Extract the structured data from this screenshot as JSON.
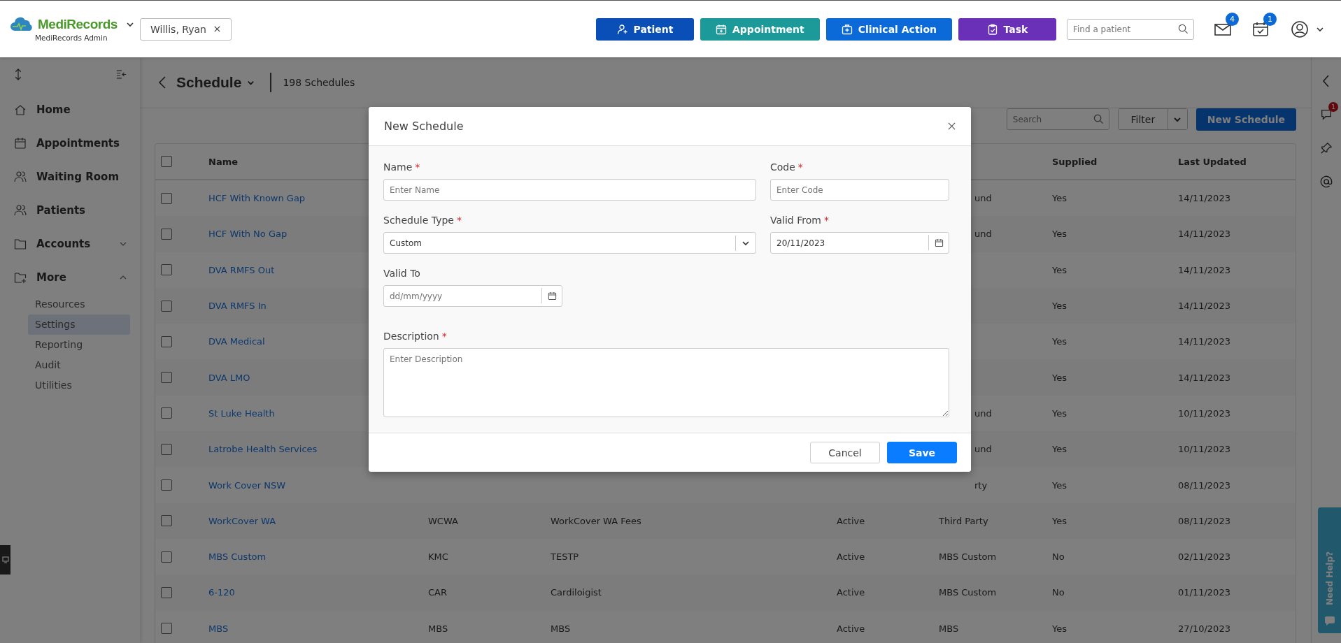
{
  "app": {
    "brand": "MediRecords",
    "subtitle": "MediRecords Admin"
  },
  "patient_chip": {
    "label": "Willis, Ryan"
  },
  "action_buttons": [
    {
      "label": "Patient",
      "kind": "patient"
    },
    {
      "label": "Appointment",
      "kind": "appointment"
    },
    {
      "label": "Clinical Action",
      "kind": "clinical"
    },
    {
      "label": "Task",
      "kind": "task"
    }
  ],
  "patient_search": {
    "placeholder": "Find a patient"
  },
  "notifications": [
    {
      "kind": "mail",
      "count": "4"
    },
    {
      "kind": "tasks",
      "count": "1"
    }
  ],
  "sidebar": {
    "items": [
      {
        "label": "Home",
        "kind": "home",
        "selected": false
      },
      {
        "label": "Appointments",
        "kind": "calendar",
        "selected": false
      },
      {
        "label": "Waiting Room",
        "kind": "waiting",
        "selected": false
      },
      {
        "label": "Patients",
        "kind": "patients",
        "selected": false
      },
      {
        "label": "Accounts",
        "kind": "folder",
        "selected": false,
        "expanded": false
      },
      {
        "label": "More",
        "kind": "folder-plus",
        "selected": false,
        "expanded": true,
        "children": [
          {
            "label": "Resources",
            "selected": false
          },
          {
            "label": "Settings",
            "selected": true
          },
          {
            "label": "Reporting",
            "selected": false
          },
          {
            "label": "Audit",
            "selected": false
          },
          {
            "label": "Utilities",
            "selected": false
          }
        ]
      }
    ]
  },
  "page": {
    "title": "Schedule",
    "count": "198 Schedules"
  },
  "toolbar": {
    "search_placeholder": "Search",
    "filter": "Filter",
    "new_button": "New Schedule"
  },
  "table": {
    "header_checked": false,
    "columns": {
      "name": "Name",
      "supplied": "Supplied",
      "last_updated": "Last Updated"
    },
    "rows": [
      {
        "checked": false,
        "name": "HCF With Known Gap",
        "type_fragment": "und",
        "supplied": "Yes",
        "last_updated": "14/11/2023"
      },
      {
        "checked": false,
        "name": "HCF With No Gap",
        "type_fragment": "und",
        "supplied": "Yes",
        "last_updated": "14/11/2023"
      },
      {
        "checked": false,
        "name": "DVA RMFS Out",
        "supplied": "Yes",
        "last_updated": "14/11/2023"
      },
      {
        "checked": false,
        "name": "DVA RMFS In",
        "supplied": "Yes",
        "last_updated": "14/11/2023"
      },
      {
        "checked": false,
        "name": "DVA Medical",
        "supplied": "Yes",
        "last_updated": "14/11/2023"
      },
      {
        "checked": false,
        "name": "DVA LMO",
        "supplied": "Yes",
        "last_updated": "14/11/2023"
      },
      {
        "checked": false,
        "name": "St Luke Health",
        "type_fragment": "und",
        "supplied": "Yes",
        "last_updated": "10/11/2023"
      },
      {
        "checked": false,
        "name": "Latrobe Health Services",
        "type_fragment": "und",
        "supplied": "Yes",
        "last_updated": "10/11/2023"
      },
      {
        "checked": false,
        "name": "Work Cover NSW",
        "type_fragment": "rty",
        "supplied": "Yes",
        "last_updated": "08/11/2023"
      },
      {
        "checked": false,
        "name": "WorkCover WA",
        "code": "WCWA",
        "description": "WorkCover WA Fees",
        "status": "Active",
        "type": "Third Party",
        "supplied": "Yes",
        "last_updated": "08/11/2023"
      },
      {
        "checked": false,
        "name": "MBS Custom",
        "code": "KMC",
        "description": "TESTP",
        "status": "Active",
        "type": "MBS Custom",
        "supplied": "No",
        "last_updated": "02/11/2023"
      },
      {
        "checked": false,
        "name": "6-120",
        "code": "CAR",
        "description": "Cardiloigist",
        "status": "Active",
        "type": "MBS Custom",
        "supplied": "No",
        "last_updated": "01/11/2023"
      },
      {
        "checked": false,
        "name": "MBS",
        "code": "MBS",
        "description": "MBS",
        "status": "Active",
        "type": "MBS",
        "supplied": "Yes",
        "last_updated": "27/10/2023"
      }
    ]
  },
  "right_rail": {
    "chat_badge": "1"
  },
  "help_tab": {
    "label": "Need Help?"
  },
  "modal": {
    "title": "New Schedule",
    "fields": [
      {
        "label": "Name",
        "required_mark": "*",
        "kind": "text",
        "placeholder": "Enter Name"
      },
      {
        "label": "Code",
        "required_mark": "*",
        "kind": "text",
        "placeholder": "Enter Code"
      },
      {
        "label": "Schedule Type",
        "required_mark": "*",
        "kind": "select",
        "value": "Custom"
      },
      {
        "label": "Valid From",
        "required_mark": "*",
        "kind": "date",
        "value": "20/11/2023"
      },
      {
        "label": "Valid To",
        "kind": "date",
        "placeholder": "dd/mm/yyyy"
      },
      {
        "label": "Description",
        "required_mark": "*",
        "kind": "textarea",
        "placeholder": "Enter Description"
      }
    ],
    "buttons": [
      {
        "label": "Cancel",
        "kind": "secondary"
      },
      {
        "label": "Save",
        "kind": "primary"
      }
    ]
  }
}
